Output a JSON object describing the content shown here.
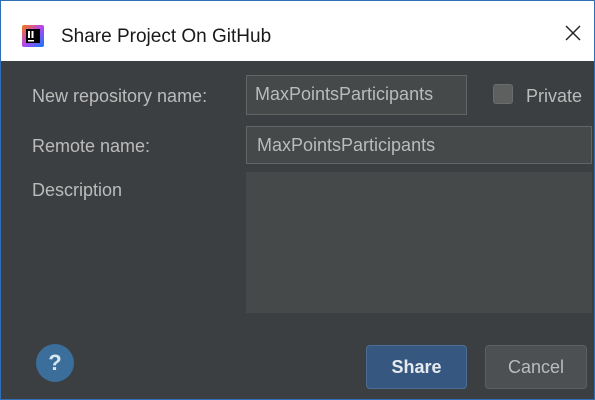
{
  "window": {
    "title": "Share Project On GitHub",
    "app_icon": "intellij-idea-icon",
    "close_icon": "close-icon"
  },
  "form": {
    "repo_name_label": "New repository name:",
    "repo_name_value": "MaxPointsParticipants",
    "repo_name_visible_text": "MaxPointsParticipants",
    "private_label": "Private",
    "private_checked": false,
    "remote_name_label": "Remote name:",
    "remote_name_value": "MaxPointsParticipants",
    "description_label": "Description",
    "description_value": ""
  },
  "footer": {
    "help_label": "?",
    "share_label": "Share",
    "cancel_label": "Cancel"
  },
  "colors": {
    "dialog_bg": "#3c3f41",
    "field_bg": "#45494a",
    "primary_button": "#365880",
    "help_button": "#3b6e9a",
    "text": "#bbbbbb",
    "titlebar_bg": "#ffffff"
  }
}
